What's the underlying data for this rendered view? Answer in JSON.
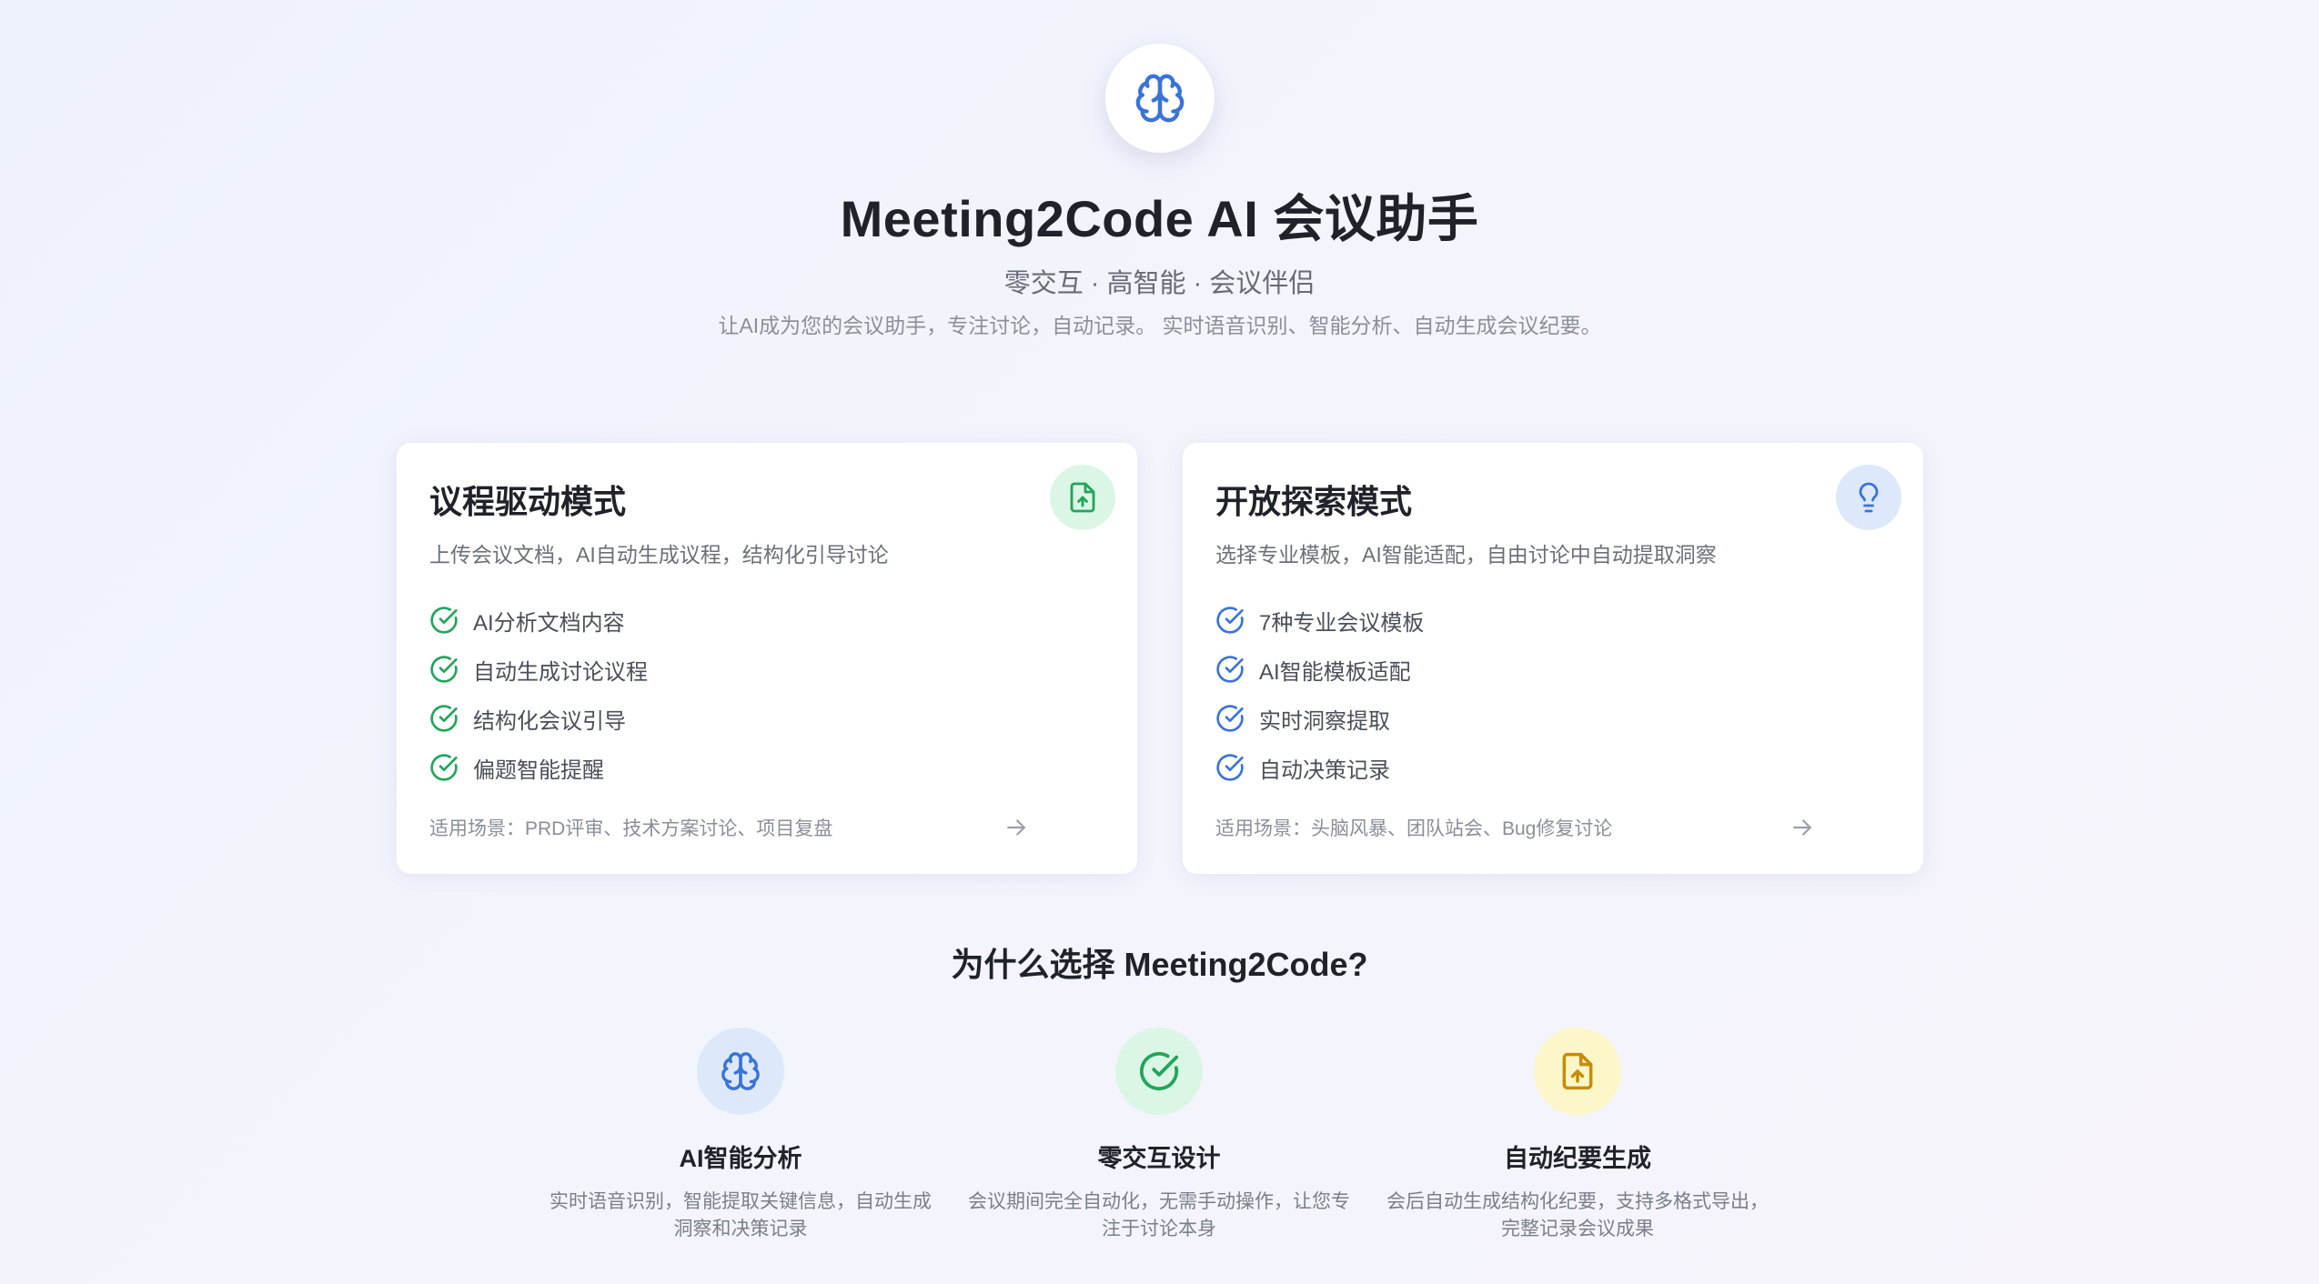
{
  "hero": {
    "logo_icon": "brain-icon",
    "title": "Meeting2Code AI 会议助手",
    "subtitle": "零交互 · 高智能 · 会议伴侣",
    "description": "让AI成为您的会议助手，专注讨论，自动记录。 实时语音识别、智能分析、自动生成会议纪要。"
  },
  "modes": [
    {
      "title": "议程驱动模式",
      "icon": "file-upload-icon",
      "accent": "#22a55a",
      "icon_bg": "#dcf6e6",
      "description": "上传会议文档，AI自动生成议程，结构化引导讨论",
      "features": [
        "AI分析文档内容",
        "自动生成讨论议程",
        "结构化会议引导",
        "偏题智能提醒"
      ],
      "scenario": "适用场景：PRD评审、技术方案讨论、项目复盘"
    },
    {
      "title": "开放探索模式",
      "icon": "lightbulb-icon",
      "accent": "#3a73d9",
      "icon_bg": "#dde9fb",
      "description": "选择专业模板，AI智能适配，自由讨论中自动提取洞察",
      "features": [
        "7种专业会议模板",
        "AI智能模板适配",
        "实时洞察提取",
        "自动决策记录"
      ],
      "scenario": "适用场景：头脑风暴、团队站会、Bug修复讨论"
    }
  ],
  "why": {
    "title": "为什么选择 Meeting2Code?",
    "items": [
      {
        "icon": "brain-icon",
        "icon_bg": "#dde9fb",
        "accent": "#3a73d9",
        "title": "AI智能分析",
        "description": "实时语音识别，智能提取关键信息，自动生成洞察和决策记录"
      },
      {
        "icon": "check-circle-icon",
        "icon_bg": "#dcf6e6",
        "accent": "#22a55a",
        "title": "零交互设计",
        "description": "会议期间完全自动化，无需手动操作，让您专注于讨论本身"
      },
      {
        "icon": "file-upload-icon",
        "icon_bg": "#fdf6c8",
        "accent": "#c98a06",
        "title": "自动纪要生成",
        "description": "会后自动生成结构化纪要，支持多格式导出，完整记录会议成果"
      }
    ]
  }
}
